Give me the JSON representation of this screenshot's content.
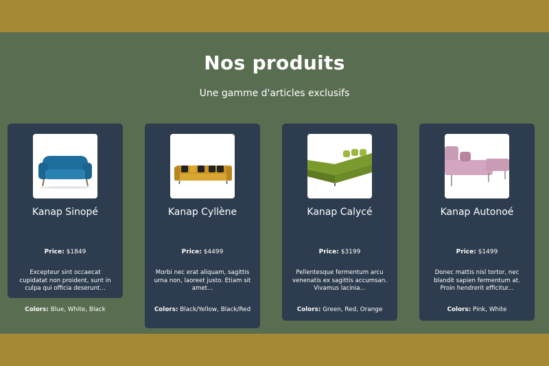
{
  "header": {
    "title": "Nos produits",
    "subtitle": "Une gamme d'articles exclusifs"
  },
  "labels": {
    "price": "Price:",
    "colors": "Colors:"
  },
  "products": [
    {
      "name": "Kanap Sinopé",
      "price": "$1849",
      "description": "Excepteur sint occaecat cupidatat non proident, sunt in culpa qui officia deserunt...",
      "colors": "Blue, White, Black",
      "image_icon": "blue-sofa-image"
    },
    {
      "name": "Kanap Cyllène",
      "price": "$4499",
      "description": "Morbi nec erat aliquam, sagittis urna non, laoreet justo. Etiam sit amet...",
      "colors": "Black/Yellow, Black/Red",
      "image_icon": "yellow-sofa-image"
    },
    {
      "name": "Kanap Calycé",
      "price": "$3199",
      "description": "Pellentesque fermentum arcu venenatis ex sagittis accumsan. Vivamus lacinia...",
      "colors": "Green, Red, Orange",
      "image_icon": "green-sectional-sofa-image"
    },
    {
      "name": "Kanap Autonoé",
      "price": "$1499",
      "description": "Donec mattis nisl tortor, nec blandit sapien fermentum at. Proin hendrerit efficitur...",
      "colors": "Pink, White",
      "image_icon": "pink-sofa-image"
    }
  ],
  "colors": {
    "band": "#a58a35",
    "background": "#596d50",
    "card": "#2d3c4e"
  }
}
